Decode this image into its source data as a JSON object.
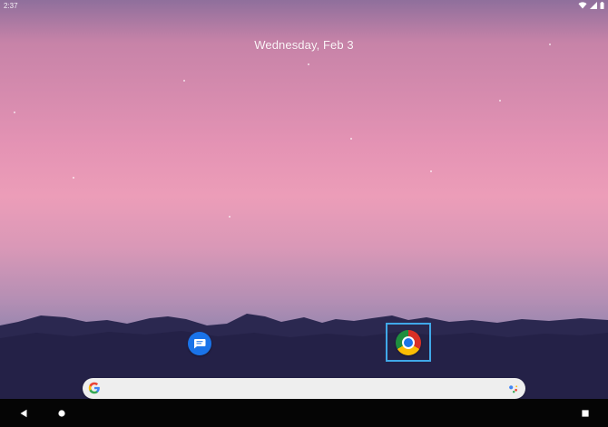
{
  "status_bar": {
    "time": "2:37",
    "icons": [
      "wifi-icon",
      "signal-icon",
      "battery-icon"
    ]
  },
  "home": {
    "date": "Wednesday, Feb 3"
  },
  "apps": [
    {
      "name": "Messages",
      "icon": "messages-icon",
      "color": "#1a73e8"
    },
    {
      "name": "Chrome",
      "icon": "chrome-icon",
      "selected": true
    }
  ],
  "search_bar": {
    "left_icon": "google-g-icon",
    "right_icon": "assistant-icon"
  },
  "navigation": {
    "buttons": [
      "back-icon",
      "home-icon",
      "recents-icon"
    ]
  },
  "colors": {
    "accent": "#40a8e8",
    "sky_top": "#8f6f9c",
    "sky_mid": "#ec9db8",
    "mountain": "#252147"
  }
}
